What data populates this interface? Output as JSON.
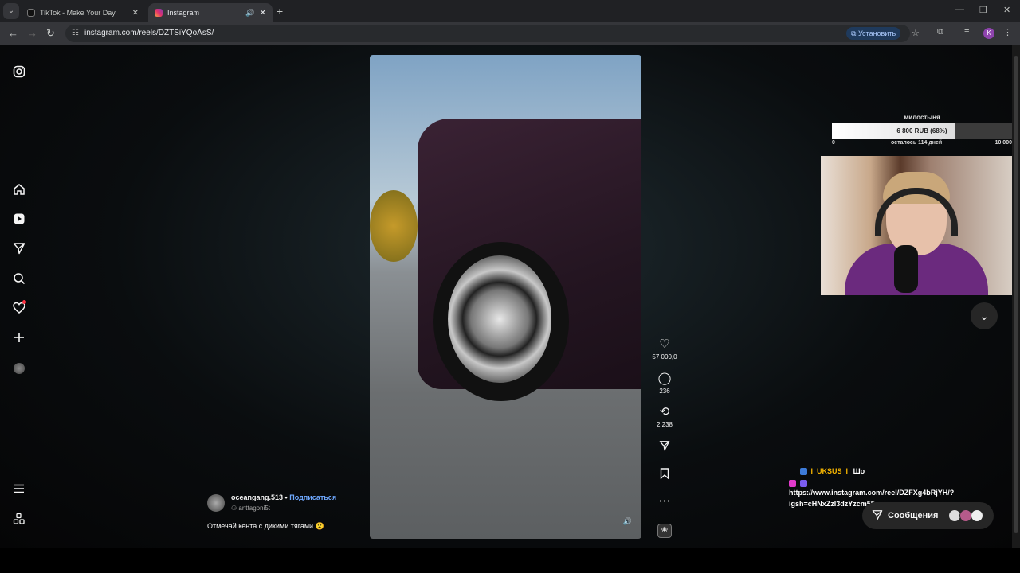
{
  "browser": {
    "tabs": [
      {
        "title": "TikTok - Make Your Day"
      },
      {
        "title": "Instagram"
      }
    ],
    "url": "instagram.com/reels/DZTSiYQoAsS/",
    "install_label": "Установить",
    "profile_initial": "K"
  },
  "reel": {
    "likes": "57 000,0",
    "comments": "236",
    "reposts": "2 238",
    "author": "oceangang.513",
    "separator": "•",
    "follow_label": "Подписаться",
    "audio_author": "anttagoni5t",
    "caption": "Отмечай кента с дикими тягами 😮"
  },
  "overlay": {
    "donation": {
      "title": "милостыня",
      "amount": "6 800 RUB (68%)",
      "progress": 0.68,
      "min": "0",
      "remaining": "осталось 114 дней",
      "max": "10 000"
    },
    "chat": [
      {
        "user": "I_UKSUS_I",
        "message": "Шо"
      },
      {
        "user": "",
        "message": "https://www.instagram.com/reel/DZFXg4bRjYH/?igsh=cHNxZzI3dzYzcm55"
      }
    ]
  },
  "messages": {
    "label": "Сообщения"
  },
  "colors": {
    "accent_follow": "#6ea8fe",
    "notification": "#ff3040",
    "chat_user": "#f5b400"
  }
}
